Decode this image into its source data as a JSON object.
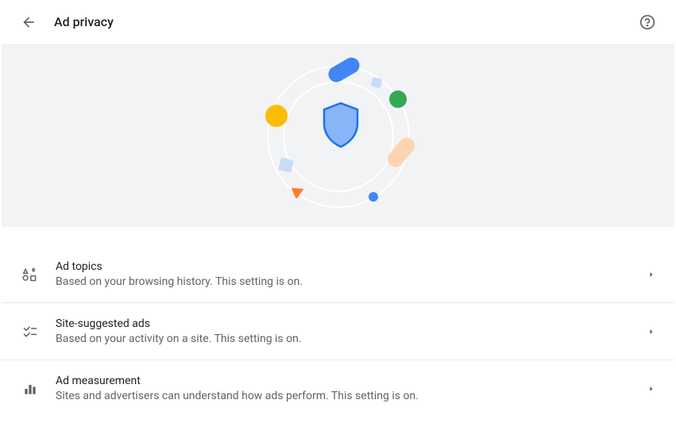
{
  "header": {
    "title": "Ad privacy"
  },
  "settings": [
    {
      "id": "ad-topics",
      "title": "Ad topics",
      "description": "Based on your browsing history. This setting is on."
    },
    {
      "id": "site-suggested-ads",
      "title": "Site-suggested ads",
      "description": "Based on your activity on a site. This setting is on."
    },
    {
      "id": "ad-measurement",
      "title": "Ad measurement",
      "description": "Sites and advertisers can understand how ads perform. This setting is on."
    }
  ]
}
